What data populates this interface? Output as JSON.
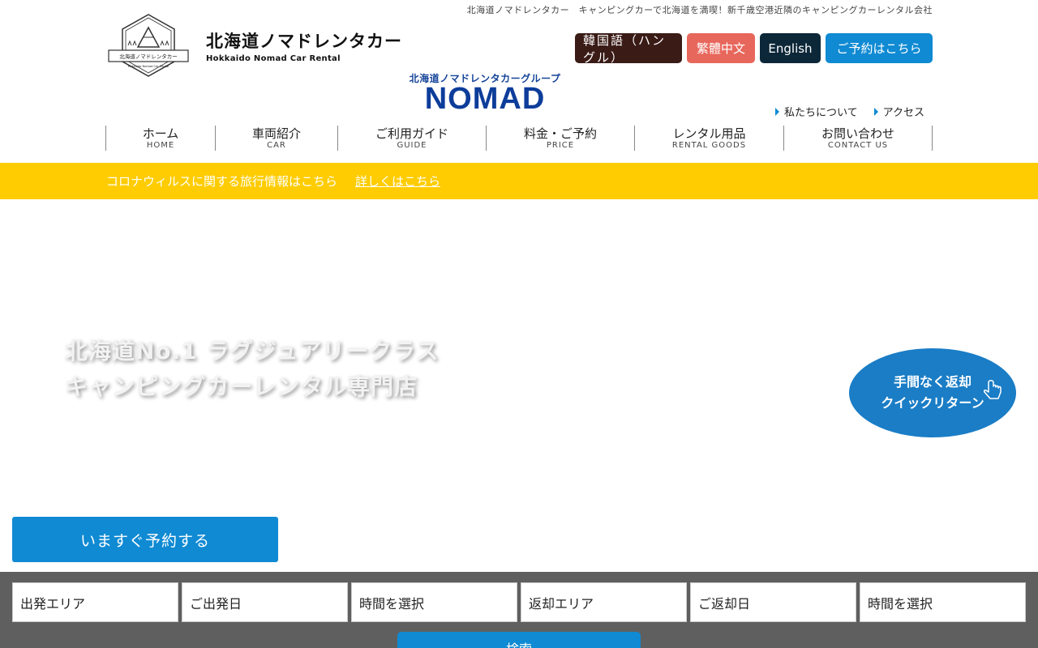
{
  "header": {
    "tagline": "北海道ノマドレンタカー　キャンピングカーで北海道を満喫！新千歳空港近隣のキャンピングカーレンタル会社",
    "logo": {
      "name_jp": "北海道ノマドレンタカー",
      "name_en": "Hokkaido Nomad Car Rental"
    },
    "languages": [
      {
        "label": "韓国語（ハングル）",
        "color": "#3a1b16"
      },
      {
        "label": "繁體中文",
        "color": "#e8675c"
      },
      {
        "label": "English",
        "color": "#0c2738"
      },
      {
        "label": "ご予約はこちら",
        "color": "#0f8ad3"
      }
    ],
    "group": {
      "sub": "北海道ノマドレンタカーグループ",
      "main": "NOMAD"
    },
    "sublinks": [
      "私たちについて",
      "アクセス"
    ]
  },
  "nav": [
    {
      "jp": "ホーム",
      "en": "HOME"
    },
    {
      "jp": "車両紹介",
      "en": "CAR"
    },
    {
      "jp": "ご利用ガイド",
      "en": "GUIDE"
    },
    {
      "jp": "料金・ご予約",
      "en": "PRICE"
    },
    {
      "jp": "レンタル用品",
      "en": "RENTAL GOODS"
    },
    {
      "jp": "お問い合わせ",
      "en": "CONTACT US"
    }
  ],
  "notice": {
    "text": "コロナウィルスに関する旅行情報はこちら",
    "link": "詳しくはこちら",
    "color": "#fecc00"
  },
  "hero": {
    "line1": "北海道No.1 ラグジュアリークラス",
    "line2": "キャンピングカーレンタル専門店",
    "quick_return": {
      "line1": "手間なく返却",
      "line2": "クイックリターン"
    }
  },
  "reserve_button": "いますぐ予約する",
  "booking": {
    "fields": [
      "出発エリア",
      "ご出発日",
      "時間を選択",
      "返却エリア",
      "ご返却日",
      "時間を選択"
    ],
    "search": "検索"
  }
}
